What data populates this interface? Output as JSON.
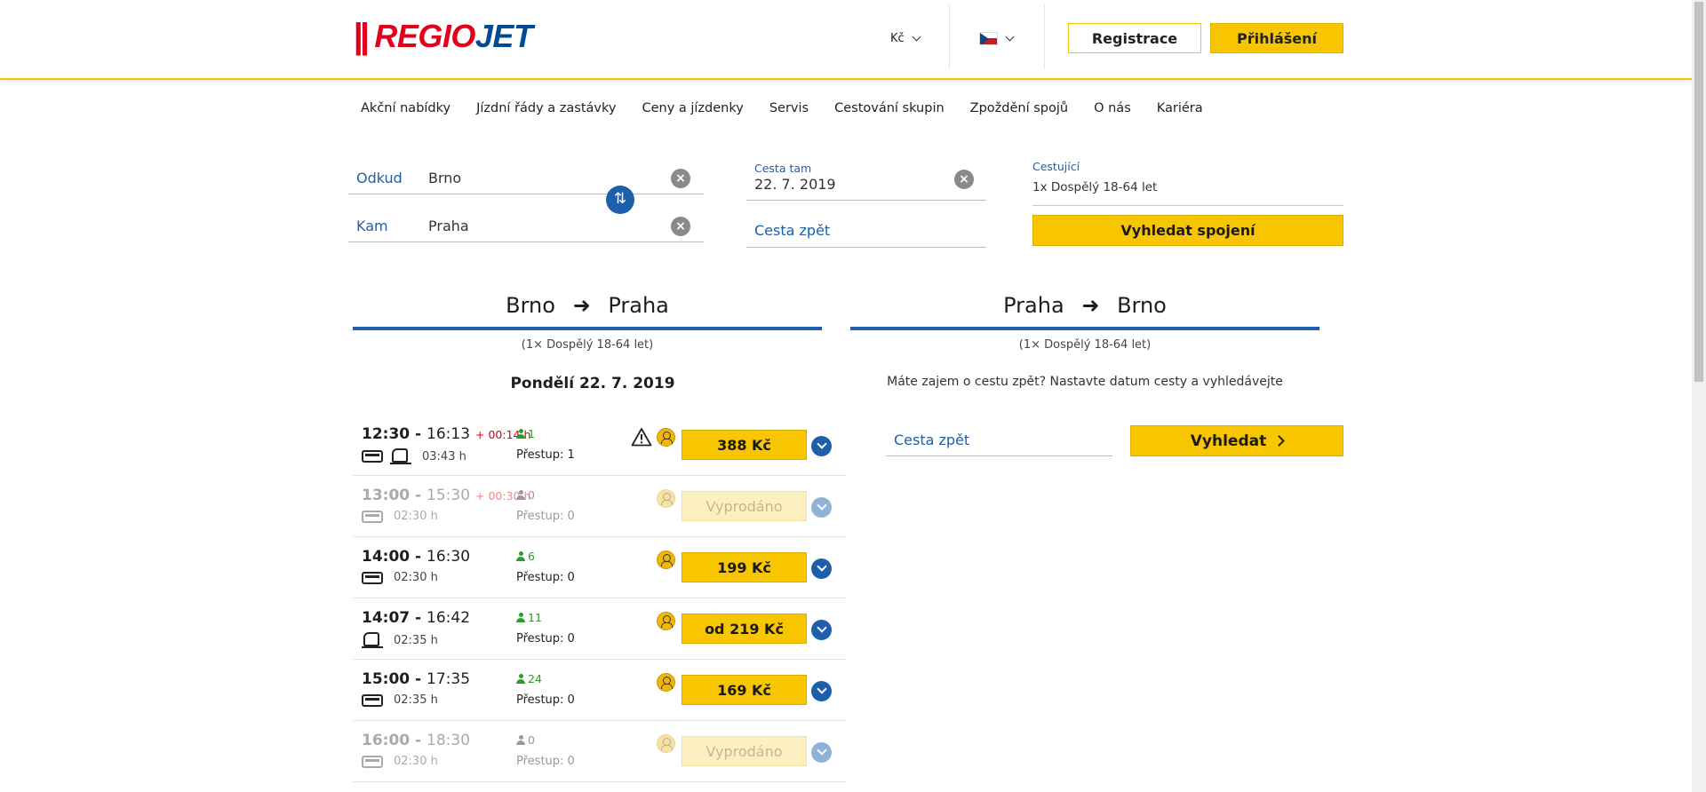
{
  "header": {
    "logo_bars": "||",
    "logo_regio": "REGIO",
    "logo_jet": "JET",
    "currency": "Kč",
    "language_flag": "cz-flag",
    "register_label": "Registrace",
    "login_label": "Přihlášení"
  },
  "nav": {
    "items": [
      "Akční nabídky",
      "Jízdní řády a zastávky",
      "Ceny a jízdenky",
      "Servis",
      "Cestování skupin",
      "Zpoždění spojů",
      "O nás",
      "Kariéra"
    ]
  },
  "search": {
    "from_label": "Odkud",
    "from_value": "Brno",
    "to_label": "Kam",
    "to_value": "Praha",
    "depart_label": "Cesta tam",
    "depart_value": "22. 7. 2019",
    "return_placeholder": "Cesta zpět",
    "passengers_label": "Cestující",
    "passengers_value": "1x Dospělý 18-64 let",
    "search_button": "Vyhledat spojení"
  },
  "outbound": {
    "from": "Brno",
    "to": "Praha",
    "passengers": "(1× Dospělý 18-64 let)",
    "day_title": "Pondělí 22. 7. 2019",
    "connections": [
      {
        "dep": "12:30",
        "arr": "16:13",
        "delay": "+ 00:14 h",
        "duration": "03:43 h",
        "seats": "1",
        "transfers": "Přestup: 1",
        "price": "388 Kč",
        "sold": false,
        "warning": true,
        "icons": [
          "bus",
          "train"
        ]
      },
      {
        "dep": "13:00",
        "arr": "15:30",
        "delay": "+ 00:30 h",
        "duration": "02:30 h",
        "seats": "0",
        "transfers": "Přestup: 0",
        "price": "Vyprodáno",
        "sold": true,
        "warning": false,
        "icons": [
          "bus"
        ]
      },
      {
        "dep": "14:00",
        "arr": "16:30",
        "delay": "",
        "duration": "02:30 h",
        "seats": "6",
        "transfers": "Přestup: 0",
        "price": "199 Kč",
        "sold": false,
        "warning": false,
        "icons": [
          "bus"
        ]
      },
      {
        "dep": "14:07",
        "arr": "16:42",
        "delay": "",
        "duration": "02:35 h",
        "seats": "11",
        "transfers": "Přestup: 0",
        "price": "od 219 Kč",
        "sold": false,
        "warning": false,
        "icons": [
          "train"
        ]
      },
      {
        "dep": "15:00",
        "arr": "17:35",
        "delay": "",
        "duration": "02:35 h",
        "seats": "24",
        "transfers": "Přestup: 0",
        "price": "169 Kč",
        "sold": false,
        "warning": false,
        "icons": [
          "bus"
        ]
      },
      {
        "dep": "16:00",
        "arr": "18:30",
        "delay": "",
        "duration": "02:30 h",
        "seats": "0",
        "transfers": "Přestup: 0",
        "price": "Vyprodáno",
        "sold": true,
        "warning": false,
        "icons": [
          "bus"
        ]
      }
    ]
  },
  "inbound": {
    "from": "Praha",
    "to": "Brno",
    "passengers": "(1× Dospělý 18-64 let)",
    "info": "Máte zajem o cestu zpět? Nastavte datum cesty a vyhledávejte",
    "return_placeholder": "Cesta zpět",
    "search_button": "Vyhledat"
  },
  "colors": {
    "accent_yellow": "#f7c600",
    "brand_blue": "#1e5fac",
    "brand_red": "#e2001a"
  }
}
